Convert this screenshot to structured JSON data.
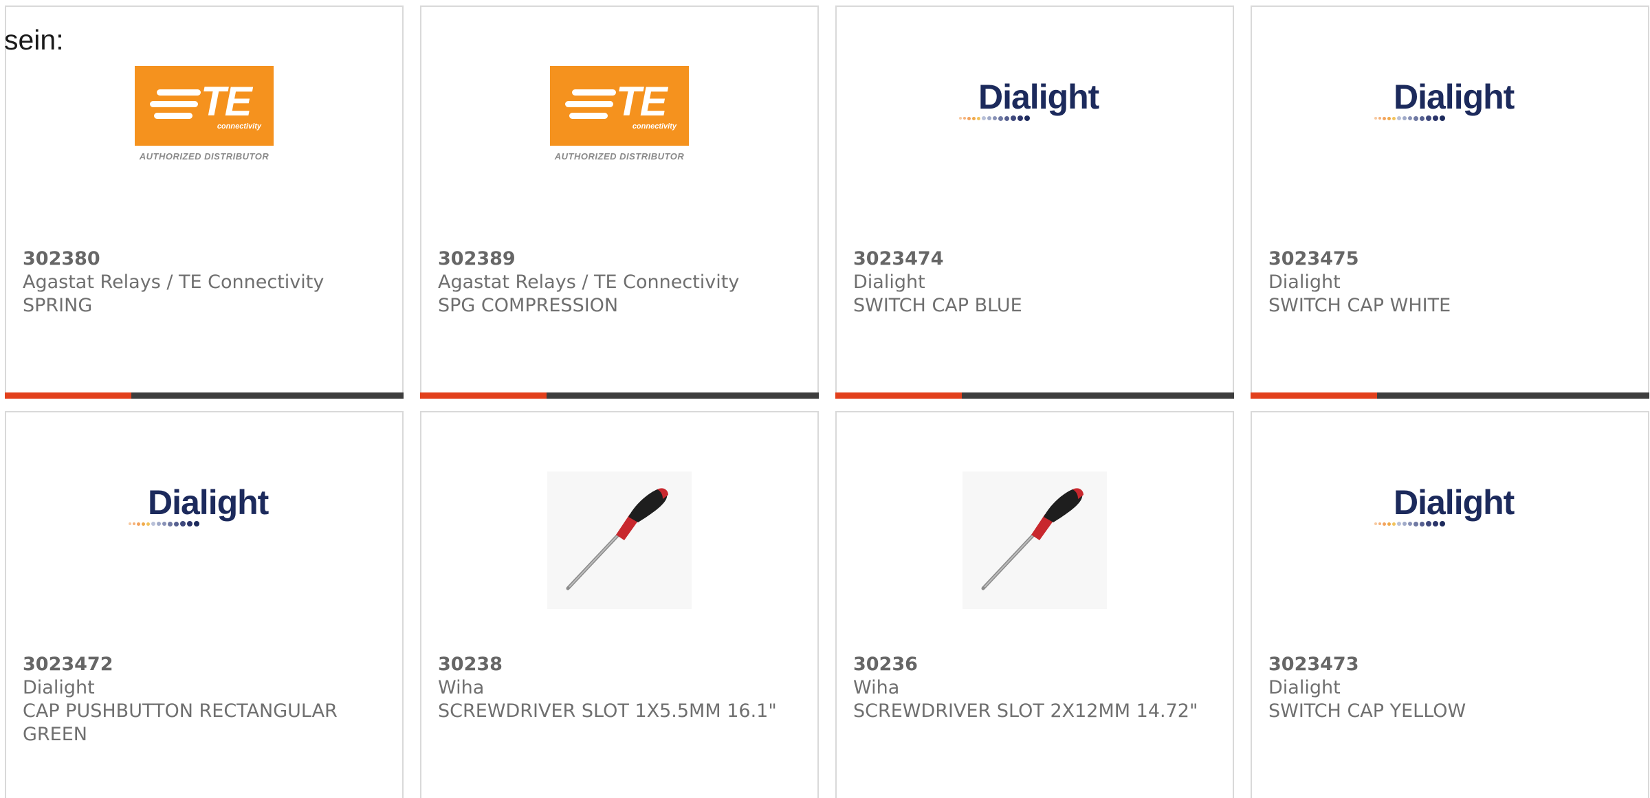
{
  "intro_text": "sein:",
  "colors": {
    "accent": "#e2401c",
    "bar": "#3d3d3d",
    "te_orange": "#f5921e",
    "dialight_navy": "#1c2a5c"
  },
  "products": [
    {
      "part_number": "302380",
      "manufacturer": "Agastat Relays / TE Connectivity",
      "description": "SPRING",
      "logo": "te-connectivity-logo",
      "logo_main": "TE",
      "logo_sub": "connectivity",
      "logo_caption": "AUTHORIZED DISTRIBUTOR"
    },
    {
      "part_number": "302389",
      "manufacturer": "Agastat Relays / TE Connectivity",
      "description": "SPG COMPRESSION",
      "logo": "te-connectivity-logo",
      "logo_main": "TE",
      "logo_sub": "connectivity",
      "logo_caption": "AUTHORIZED DISTRIBUTOR"
    },
    {
      "part_number": "3023474",
      "manufacturer": "Dialight",
      "description": "SWITCH CAP BLUE",
      "logo": "dialight-logo",
      "logo_main": "Dialight"
    },
    {
      "part_number": "3023475",
      "manufacturer": "Dialight",
      "description": "SWITCH CAP WHITE",
      "logo": "dialight-logo",
      "logo_main": "Dialight"
    },
    {
      "part_number": "3023472",
      "manufacturer": "Dialight",
      "description": "CAP PUSHBUTTON RECTANGULAR GREEN",
      "logo": "dialight-logo",
      "logo_main": "Dialight"
    },
    {
      "part_number": "30238",
      "manufacturer": "Wiha",
      "description": "SCREWDRIVER SLOT 1X5.5MM 16.1\"",
      "logo": "screwdriver-image"
    },
    {
      "part_number": "30236",
      "manufacturer": "Wiha",
      "description": "SCREWDRIVER SLOT 2X12MM 14.72\"",
      "logo": "screwdriver-image"
    },
    {
      "part_number": "3023473",
      "manufacturer": "Dialight",
      "description": "SWITCH CAP YELLOW",
      "logo": "dialight-logo",
      "logo_main": "Dialight"
    }
  ]
}
